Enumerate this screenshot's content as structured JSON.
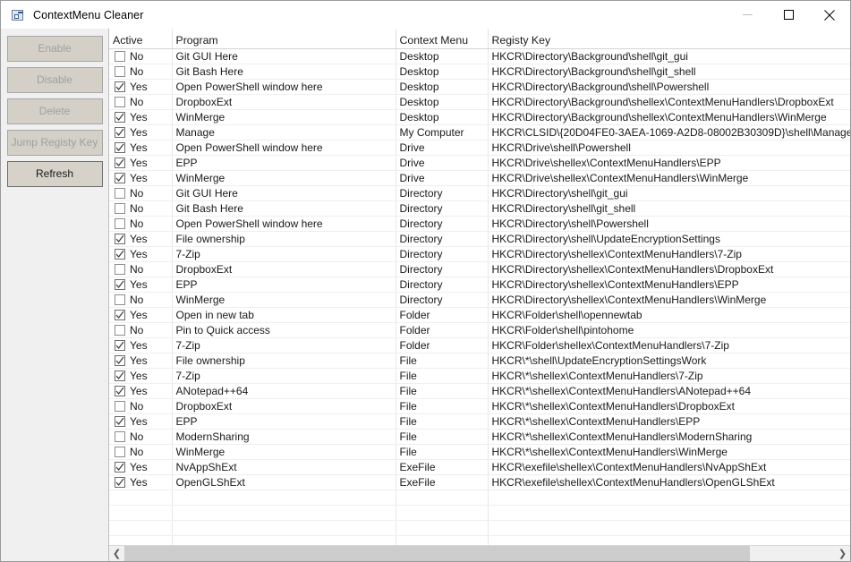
{
  "window": {
    "title": "ContextMenu Cleaner",
    "icon": "app-icon",
    "controls": {
      "minimize": "minimize-icon",
      "maximize": "maximize-icon",
      "close": "close-icon"
    }
  },
  "sidebar": {
    "buttons": [
      {
        "label": "Enable",
        "enabled": false
      },
      {
        "label": "Disable",
        "enabled": false
      },
      {
        "label": "Delete",
        "enabled": false
      },
      {
        "label": "Jump Registy Key",
        "enabled": false
      },
      {
        "label": "Refresh",
        "enabled": true
      }
    ]
  },
  "grid": {
    "columns": [
      "Active",
      "Program",
      "Context Menu",
      "Registy Key"
    ],
    "yes_label": "Yes",
    "no_label": "No",
    "empty_row_count": 4,
    "rows": [
      {
        "active": false,
        "program": "Git GUI Here",
        "context": "Desktop",
        "registry": "HKCR\\Directory\\Background\\shell\\git_gui"
      },
      {
        "active": false,
        "program": "Git Bash Here",
        "context": "Desktop",
        "registry": "HKCR\\Directory\\Background\\shell\\git_shell"
      },
      {
        "active": true,
        "program": "Open PowerShell window here",
        "context": "Desktop",
        "registry": "HKCR\\Directory\\Background\\shell\\Powershell"
      },
      {
        "active": false,
        "program": "DropboxExt",
        "context": "Desktop",
        "registry": "HKCR\\Directory\\Background\\shellex\\ContextMenuHandlers\\DropboxExt"
      },
      {
        "active": true,
        "program": "WinMerge",
        "context": "Desktop",
        "registry": "HKCR\\Directory\\Background\\shellex\\ContextMenuHandlers\\WinMerge"
      },
      {
        "active": true,
        "program": "Manage",
        "context": "My Computer",
        "registry": "HKCR\\CLSID\\{20D04FE0-3AEA-1069-A2D8-08002B30309D}\\shell\\Manage"
      },
      {
        "active": true,
        "program": "Open PowerShell window here",
        "context": "Drive",
        "registry": "HKCR\\Drive\\shell\\Powershell"
      },
      {
        "active": true,
        "program": "EPP",
        "context": "Drive",
        "registry": "HKCR\\Drive\\shellex\\ContextMenuHandlers\\EPP"
      },
      {
        "active": true,
        "program": "WinMerge",
        "context": "Drive",
        "registry": "HKCR\\Drive\\shellex\\ContextMenuHandlers\\WinMerge"
      },
      {
        "active": false,
        "program": "Git GUI Here",
        "context": "Directory",
        "registry": "HKCR\\Directory\\shell\\git_gui"
      },
      {
        "active": false,
        "program": "Git Bash Here",
        "context": "Directory",
        "registry": "HKCR\\Directory\\shell\\git_shell"
      },
      {
        "active": false,
        "program": "Open PowerShell window here",
        "context": "Directory",
        "registry": "HKCR\\Directory\\shell\\Powershell"
      },
      {
        "active": true,
        "program": "File ownership",
        "context": "Directory",
        "registry": "HKCR\\Directory\\shell\\UpdateEncryptionSettings"
      },
      {
        "active": true,
        "program": "7-Zip",
        "context": "Directory",
        "registry": "HKCR\\Directory\\shellex\\ContextMenuHandlers\\7-Zip"
      },
      {
        "active": false,
        "program": "DropboxExt",
        "context": "Directory",
        "registry": "HKCR\\Directory\\shellex\\ContextMenuHandlers\\DropboxExt"
      },
      {
        "active": true,
        "program": "EPP",
        "context": "Directory",
        "registry": "HKCR\\Directory\\shellex\\ContextMenuHandlers\\EPP"
      },
      {
        "active": false,
        "program": "WinMerge",
        "context": "Directory",
        "registry": "HKCR\\Directory\\shellex\\ContextMenuHandlers\\WinMerge"
      },
      {
        "active": true,
        "program": "Open in new tab",
        "context": "Folder",
        "registry": "HKCR\\Folder\\shell\\opennewtab"
      },
      {
        "active": false,
        "program": "Pin to Quick access",
        "context": "Folder",
        "registry": "HKCR\\Folder\\shell\\pintohome"
      },
      {
        "active": true,
        "program": "7-Zip",
        "context": "Folder",
        "registry": "HKCR\\Folder\\shellex\\ContextMenuHandlers\\7-Zip"
      },
      {
        "active": true,
        "program": "File ownership",
        "context": "File",
        "registry": "HKCR\\*\\shell\\UpdateEncryptionSettingsWork"
      },
      {
        "active": true,
        "program": "7-Zip",
        "context": "File",
        "registry": "HKCR\\*\\shellex\\ContextMenuHandlers\\7-Zip"
      },
      {
        "active": true,
        "program": "ANotepad++64",
        "context": "File",
        "registry": "HKCR\\*\\shellex\\ContextMenuHandlers\\ANotepad++64"
      },
      {
        "active": false,
        "program": "DropboxExt",
        "context": "File",
        "registry": "HKCR\\*\\shellex\\ContextMenuHandlers\\DropboxExt"
      },
      {
        "active": true,
        "program": "EPP",
        "context": "File",
        "registry": "HKCR\\*\\shellex\\ContextMenuHandlers\\EPP"
      },
      {
        "active": false,
        "program": "ModernSharing",
        "context": "File",
        "registry": "HKCR\\*\\shellex\\ContextMenuHandlers\\ModernSharing"
      },
      {
        "active": false,
        "program": "WinMerge",
        "context": "File",
        "registry": "HKCR\\*\\shellex\\ContextMenuHandlers\\WinMerge"
      },
      {
        "active": true,
        "program": "NvAppShExt",
        "context": "ExeFile",
        "registry": "HKCR\\exefile\\shellex\\ContextMenuHandlers\\NvAppShExt"
      },
      {
        "active": true,
        "program": "OpenGLShExt",
        "context": "ExeFile",
        "registry": "HKCR\\exefile\\shellex\\ContextMenuHandlers\\OpenGLShExt"
      }
    ]
  },
  "scrollbar": {
    "left_arrow": "chevron-left-icon",
    "right_arrow": "chevron-right-icon",
    "thumb_fraction": 88
  }
}
